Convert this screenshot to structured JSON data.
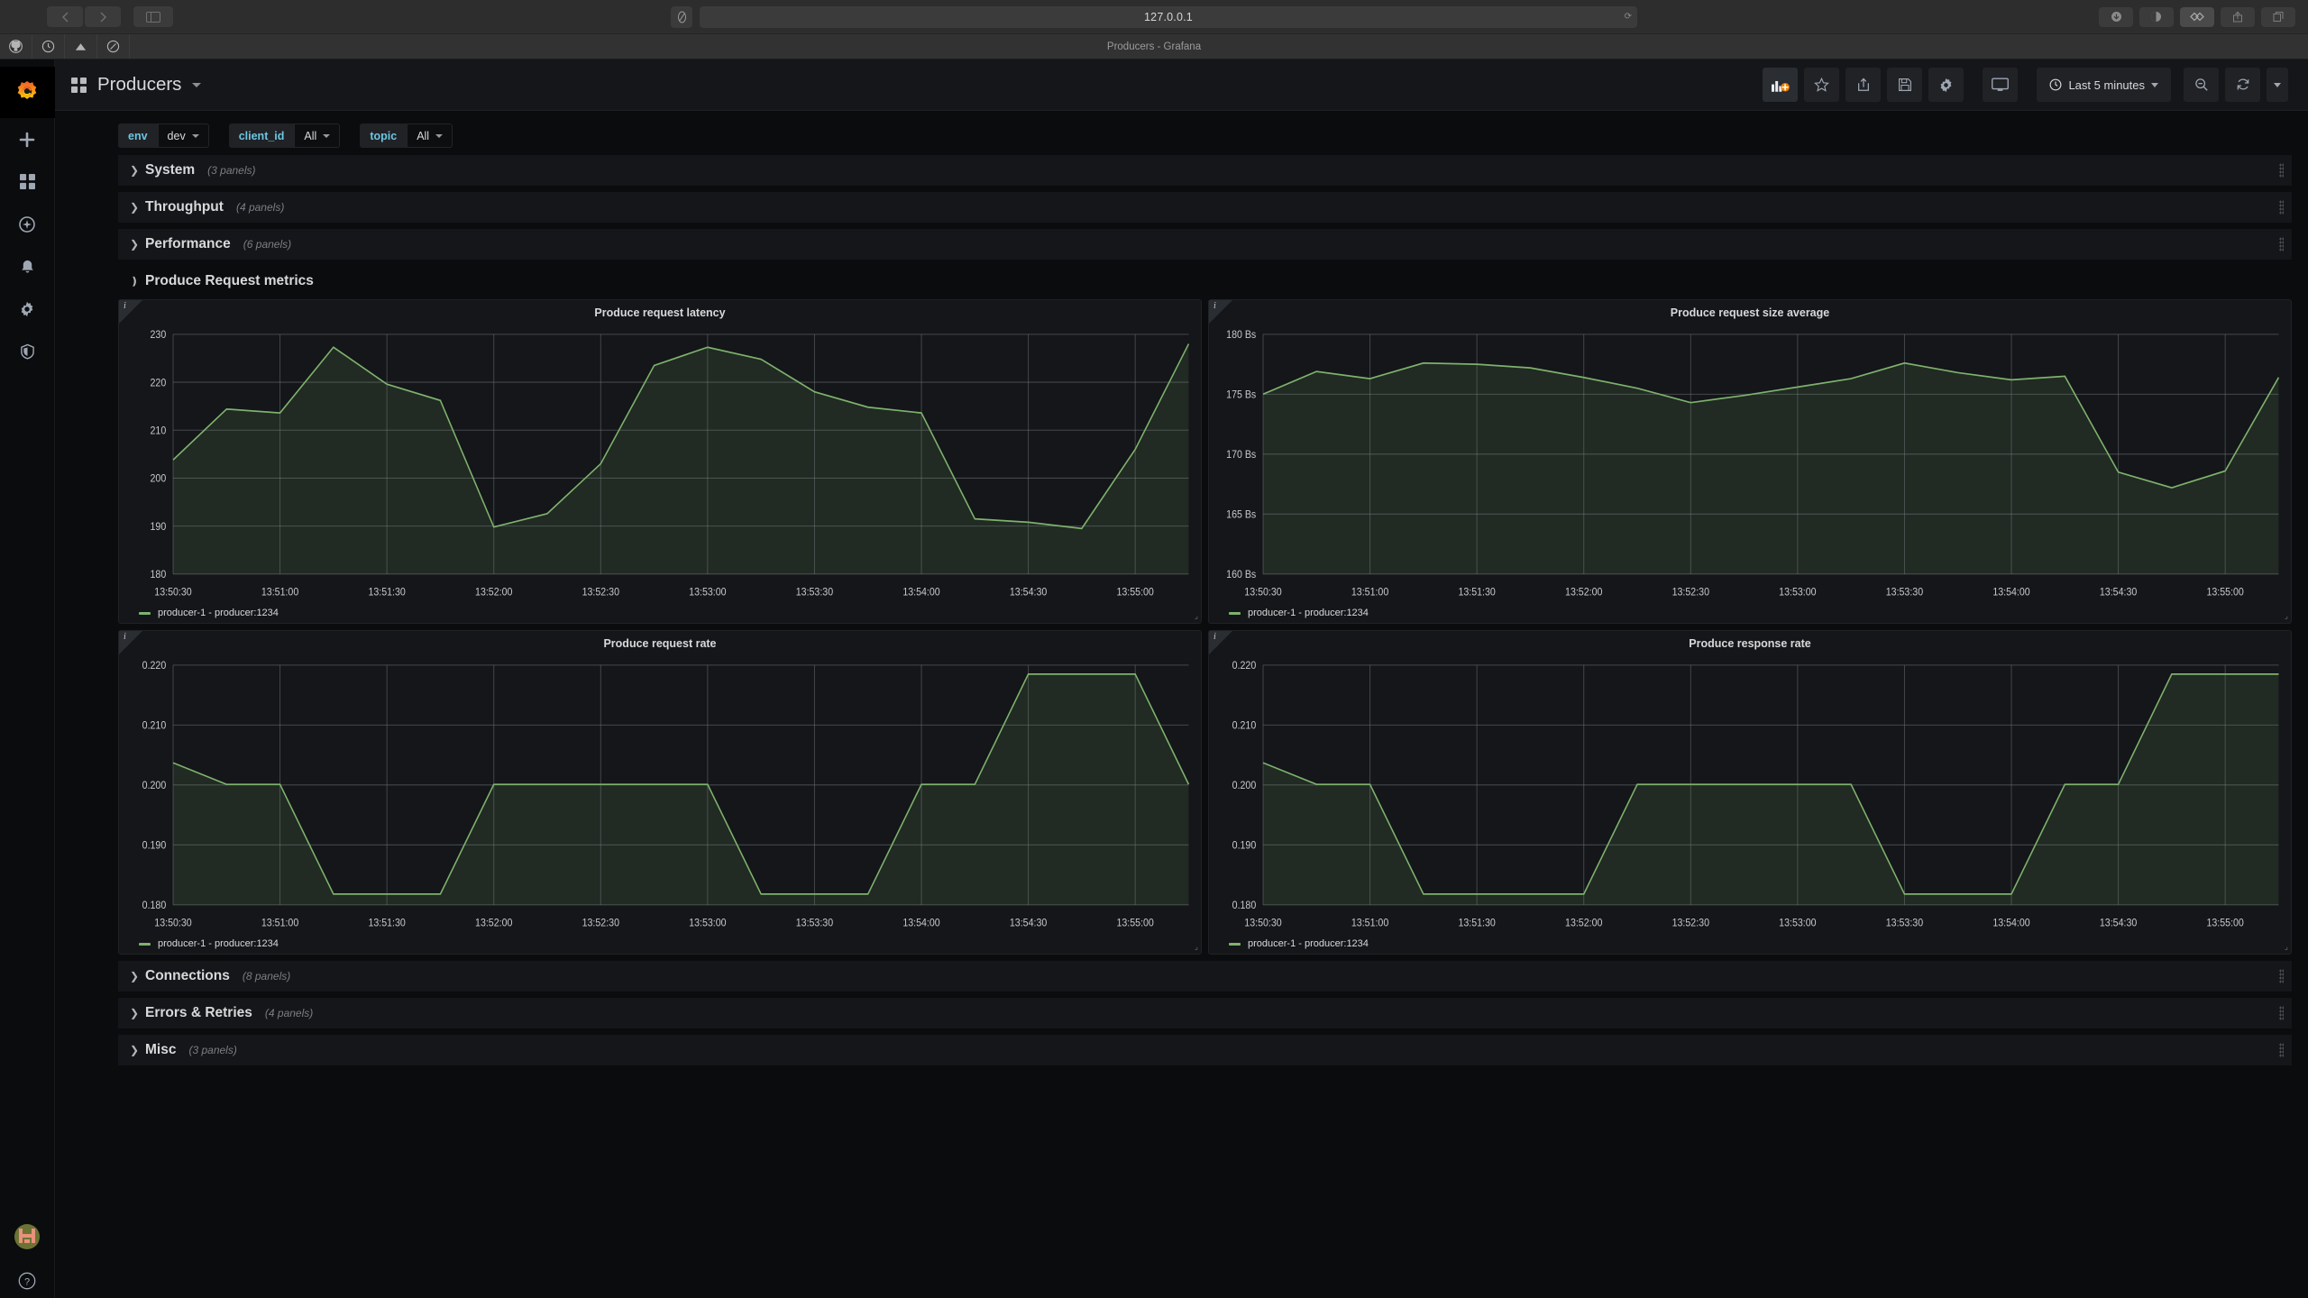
{
  "browser": {
    "url": "127.0.0.1",
    "tab_title": "Producers - Grafana",
    "nav_back_icon": "chevron-left-icon",
    "nav_forward_icon": "chevron-right-icon",
    "sidebar_icon": "sidebar-panel-icon",
    "shield_icon": "shield-icon",
    "reload_icon": "reload-icon",
    "bookmarks": [
      "github-icon",
      "clock-icon",
      "triangle-icon",
      "compass-icon"
    ],
    "right_buttons": [
      "download-icon",
      "dark-mode-icon",
      "extension-icon",
      "share-icon",
      "tabs-icon"
    ]
  },
  "sidemenu": {
    "logo": "grafana-logo",
    "items": [
      {
        "name": "create",
        "icon": "plus-icon"
      },
      {
        "name": "dashboards",
        "icon": "apps-grid-icon"
      },
      {
        "name": "explore",
        "icon": "compass-icon"
      },
      {
        "name": "alerting",
        "icon": "bell-icon"
      },
      {
        "name": "configuration",
        "icon": "gear-icon"
      },
      {
        "name": "server-admin",
        "icon": "shield-icon"
      }
    ],
    "avatar": "user-avatar",
    "help": "?"
  },
  "navbar": {
    "dashboard_icon": "apps-grid-icon",
    "title": "Producers",
    "actions": [
      {
        "name": "add-panel",
        "icon": "add-panel-icon",
        "active": true
      },
      {
        "name": "mark-favorite",
        "icon": "star-icon",
        "active": false
      },
      {
        "name": "share-dashboard",
        "icon": "share-icon",
        "active": false
      },
      {
        "name": "save-dashboard",
        "icon": "save-icon",
        "active": false
      },
      {
        "name": "dashboard-settings",
        "icon": "gear-icon",
        "active": false
      },
      {
        "name": "cycle-view-mode",
        "icon": "monitor-icon",
        "active": false
      }
    ],
    "time_range": "Last 5 minutes",
    "time_icon": "clock-icon",
    "zoom_out": "search-minus-icon",
    "refresh": "refresh-icon",
    "refresh_interval_caret": "chevron-down-icon"
  },
  "variables": [
    {
      "label": "env",
      "value": "dev"
    },
    {
      "label": "client_id",
      "value": "All"
    },
    {
      "label": "topic",
      "value": "All"
    }
  ],
  "rows": [
    {
      "title": "System",
      "count": "(3 panels)",
      "expanded": false
    },
    {
      "title": "Throughput",
      "count": "(4 panels)",
      "expanded": false
    },
    {
      "title": "Performance",
      "count": "(6 panels)",
      "expanded": false
    },
    {
      "title": "Produce Request metrics",
      "count": "",
      "expanded": true
    },
    {
      "title": "Connections",
      "count": "(8 panels)",
      "expanded": false
    },
    {
      "title": "Errors & Retries",
      "count": "(4 panels)",
      "expanded": false
    },
    {
      "title": "Misc",
      "count": "(3 panels)",
      "expanded": false
    }
  ],
  "legend_series": "producer-1 - producer:1234",
  "chart_data": [
    {
      "id": "produce-request-latency",
      "type": "line",
      "title": "Produce request latency",
      "legend": [
        "producer-1 - producer:1234"
      ],
      "legend_position": "bottom",
      "grid": true,
      "color": "#7eb26d",
      "xlabel": "",
      "ylabel": "",
      "ylim": [
        180,
        230
      ],
      "yticks": [
        180,
        190,
        200,
        210,
        220,
        230
      ],
      "ytick_labels": [
        "180",
        "190",
        "200",
        "210",
        "220",
        "230"
      ],
      "xticks": [
        "13:50:30",
        "13:51:00",
        "13:51:30",
        "13:52:00",
        "13:52:30",
        "13:53:00",
        "13:53:30",
        "13:54:00",
        "13:54:30",
        "13:55:00"
      ],
      "x": [
        "13:50:30",
        "13:50:45",
        "13:51:00",
        "13:51:15",
        "13:51:30",
        "13:51:45",
        "13:52:00",
        "13:52:15",
        "13:52:30",
        "13:52:45",
        "13:53:00",
        "13:53:15",
        "13:53:30",
        "13:53:45",
        "13:54:00",
        "13:54:15",
        "13:54:30",
        "13:54:45",
        "13:55:00",
        "13:55:15"
      ],
      "values": [
        203.8,
        214.4,
        213.6,
        227.3,
        219.6,
        216.2,
        189.8,
        192.6,
        203.0,
        223.5,
        227.3,
        224.8,
        218.0,
        214.8,
        213.6,
        191.5,
        190.8,
        189.5,
        206.0,
        228.0
      ]
    },
    {
      "id": "produce-request-size-average",
      "type": "line",
      "title": "Produce request size average",
      "legend": [
        "producer-1 - producer:1234"
      ],
      "legend_position": "bottom",
      "grid": true,
      "color": "#7eb26d",
      "xlabel": "",
      "ylabel": "",
      "ylim": [
        160,
        180
      ],
      "yticks": [
        160,
        165,
        170,
        175,
        180
      ],
      "ytick_labels": [
        "160 Bs",
        "165 Bs",
        "170 Bs",
        "175 Bs",
        "180 Bs"
      ],
      "xticks": [
        "13:50:30",
        "13:51:00",
        "13:51:30",
        "13:52:00",
        "13:52:30",
        "13:53:00",
        "13:53:30",
        "13:54:00",
        "13:54:30",
        "13:55:00"
      ],
      "x": [
        "13:50:30",
        "13:50:45",
        "13:51:00",
        "13:51:15",
        "13:51:30",
        "13:51:45",
        "13:52:00",
        "13:52:15",
        "13:52:30",
        "13:52:45",
        "13:53:00",
        "13:53:15",
        "13:53:30",
        "13:53:45",
        "13:54:00",
        "13:54:15",
        "13:54:30",
        "13:54:45",
        "13:55:00",
        "13:55:15"
      ],
      "values": [
        175.0,
        176.9,
        176.3,
        177.6,
        177.5,
        177.2,
        176.4,
        175.5,
        174.3,
        174.9,
        175.6,
        176.3,
        177.6,
        176.8,
        176.2,
        176.5,
        168.5,
        167.2,
        168.6,
        176.4
      ]
    },
    {
      "id": "produce-request-rate",
      "type": "line",
      "title": "Produce request rate",
      "legend": [
        "producer-1 - producer:1234"
      ],
      "legend_position": "bottom",
      "grid": true,
      "color": "#7eb26d",
      "xlabel": "",
      "ylabel": "",
      "ylim": [
        0.18,
        0.22
      ],
      "yticks": [
        0.18,
        0.19,
        0.2,
        0.21,
        0.22
      ],
      "ytick_labels": [
        "0.180",
        "0.190",
        "0.200",
        "0.210",
        "0.220"
      ],
      "xticks": [
        "13:50:30",
        "13:51:00",
        "13:51:30",
        "13:52:00",
        "13:52:30",
        "13:53:00",
        "13:53:30",
        "13:54:00",
        "13:54:30",
        "13:55:00"
      ],
      "x": [
        "13:50:30",
        "13:50:45",
        "13:51:00",
        "13:51:15",
        "13:51:30",
        "13:51:45",
        "13:52:00",
        "13:52:15",
        "13:52:30",
        "13:52:45",
        "13:53:00",
        "13:53:15",
        "13:53:30",
        "13:53:45",
        "13:54:00",
        "13:54:15",
        "13:54:30",
        "13:54:45",
        "13:55:00",
        "13:55:15"
      ],
      "values": [
        0.2037,
        0.2001,
        0.2001,
        0.1818,
        0.1818,
        0.1818,
        0.2001,
        0.2001,
        0.2001,
        0.2001,
        0.2001,
        0.1818,
        0.1818,
        0.1818,
        0.2001,
        0.2001,
        0.2185,
        0.2185,
        0.2185,
        0.2001
      ]
    },
    {
      "id": "produce-response-rate",
      "type": "line",
      "title": "Produce response rate",
      "legend": [
        "producer-1 - producer:1234"
      ],
      "legend_position": "bottom",
      "grid": true,
      "color": "#7eb26d",
      "xlabel": "",
      "ylabel": "",
      "ylim": [
        0.18,
        0.22
      ],
      "yticks": [
        0.18,
        0.19,
        0.2,
        0.21,
        0.22
      ],
      "ytick_labels": [
        "0.180",
        "0.190",
        "0.200",
        "0.210",
        "0.220"
      ],
      "xticks": [
        "13:50:30",
        "13:51:00",
        "13:51:30",
        "13:52:00",
        "13:52:30",
        "13:53:00",
        "13:53:30",
        "13:54:00",
        "13:54:30",
        "13:55:00"
      ],
      "x": [
        "13:50:30",
        "13:50:45",
        "13:51:00",
        "13:51:15",
        "13:51:30",
        "13:51:45",
        "13:52:00",
        "13:52:15",
        "13:52:30",
        "13:52:45",
        "13:53:00",
        "13:53:15",
        "13:53:30",
        "13:53:45",
        "13:54:00",
        "13:54:15",
        "13:54:30",
        "13:54:45",
        "13:55:00",
        "13:55:15"
      ],
      "values": [
        0.2037,
        0.2001,
        0.2001,
        0.1818,
        0.1818,
        0.1818,
        0.1818,
        0.2001,
        0.2001,
        0.2001,
        0.2001,
        0.2001,
        0.1818,
        0.1818,
        0.1818,
        0.2001,
        0.2001,
        0.2185,
        0.2185,
        0.2185
      ]
    }
  ],
  "colors": {
    "series": "#7eb26d",
    "panel_bg": "#141619",
    "app_bg": "#0b0c0e",
    "accent_blue": "#6cc6e2",
    "text": "#d8d9da"
  }
}
